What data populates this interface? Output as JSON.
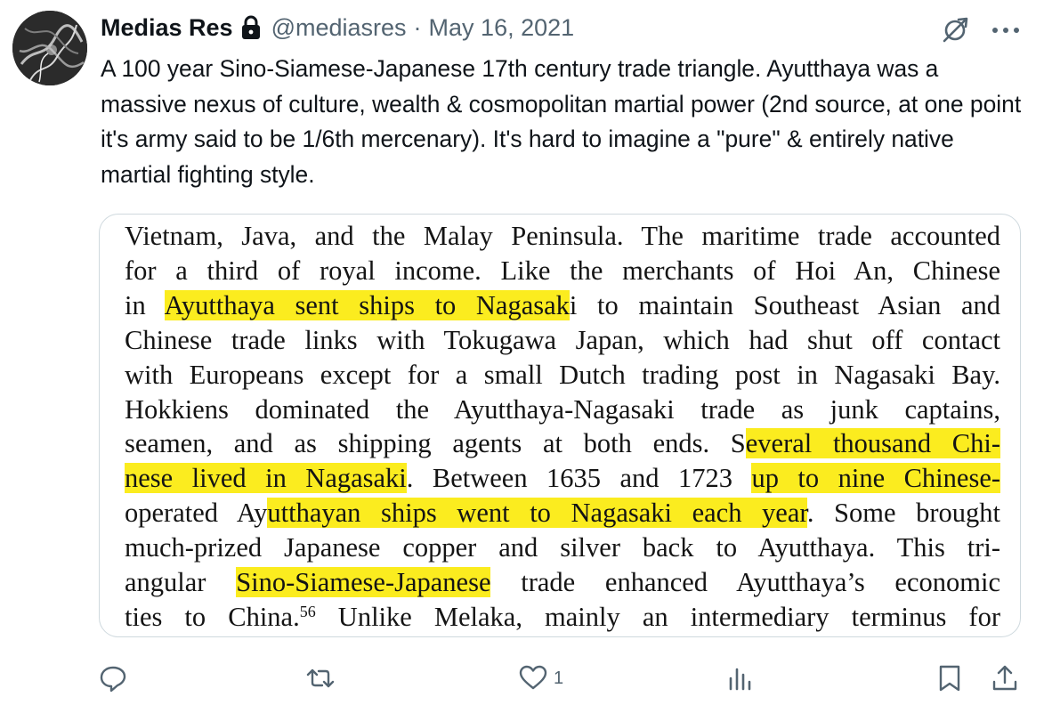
{
  "author": {
    "display_name": "Medias Res",
    "handle": "@mediasres",
    "separator": "·",
    "date": "May 16, 2021",
    "protected_icon": "lock-icon"
  },
  "tweet": {
    "text": "A 100 year Sino-Siamese-Japanese 17th century trade triangle. Ayutthaya was a massive nexus of culture, wealth & cosmopolitan martial power (2nd source, at one point it's army said to be 1/6th mercenary). It's hard to imagine a \"pure\" & entirely native martial fighting style."
  },
  "media": {
    "highlight_color": "#fbec1f",
    "lines": [
      {
        "segments": [
          {
            "text": "Vietnam, Java, and the Malay Peninsula. The maritime trade accounted",
            "hl": false
          }
        ]
      },
      {
        "segments": [
          {
            "text": "for a third of royal income. Like the merchants of Hoi An, Chinese",
            "hl": false
          }
        ]
      },
      {
        "segments": [
          {
            "text": "in ",
            "hl": false
          },
          {
            "text": "Ayutthaya sent ships to Nagasak",
            "hl": true
          },
          {
            "text": "i to maintain Southeast Asian and",
            "hl": false
          }
        ]
      },
      {
        "segments": [
          {
            "text": "Chinese trade links with Tokugawa Japan, which had shut off contact",
            "hl": false
          }
        ]
      },
      {
        "segments": [
          {
            "text": "with Europeans except for a small Dutch trading post in Nagasaki Bay.",
            "hl": false
          }
        ]
      },
      {
        "segments": [
          {
            "text": "Hokkiens dominated the Ayutthaya-Nagasaki trade as junk captains,",
            "hl": false
          }
        ]
      },
      {
        "segments": [
          {
            "text": "seamen, and as shipping agents at both ends. S",
            "hl": false
          },
          {
            "text": "everal thousand Chi-",
            "hl": true
          }
        ]
      },
      {
        "segments": [
          {
            "text": "nese lived in Nagasaki",
            "hl": true
          },
          {
            "text": ". Between 1635 and 1723 ",
            "hl": false
          },
          {
            "text": "up to nine Chinese-",
            "hl": true
          }
        ]
      },
      {
        "segments": [
          {
            "text": "operated Ay",
            "hl": false
          },
          {
            "text": "utthayan ships went to Nagasaki each year",
            "hl": true
          },
          {
            "text": ". Some brought",
            "hl": false
          }
        ]
      },
      {
        "segments": [
          {
            "text": "much-prized Japanese copper and silver back to Ayutthaya. This tri-",
            "hl": false
          }
        ]
      },
      {
        "segments": [
          {
            "text": "angular ",
            "hl": false
          },
          {
            "text": "Sino-Siamese-Japanese",
            "hl": true
          },
          {
            "text": " trade enhanced Ayutthaya’s economic",
            "hl": false
          }
        ]
      },
      {
        "segments": [
          {
            "text": "ties to China.",
            "hl": false
          },
          {
            "text": "56",
            "hl": false,
            "sup": true
          },
          {
            "text": " Unlike Melaka, mainly an intermediary terminus for",
            "hl": false
          }
        ]
      }
    ]
  },
  "actions": {
    "reply_icon": "reply-icon",
    "retweet_icon": "retweet-icon",
    "like_icon": "like-icon",
    "like_count": "1",
    "views_icon": "views-icon",
    "bookmark_icon": "bookmark-icon",
    "share_icon": "share-icon"
  },
  "header_icons": {
    "grok": "grok-icon",
    "more": "more-icon"
  },
  "colors": {
    "text_primary": "#0f1419",
    "text_secondary": "#536471",
    "border": "#cfd9de"
  }
}
